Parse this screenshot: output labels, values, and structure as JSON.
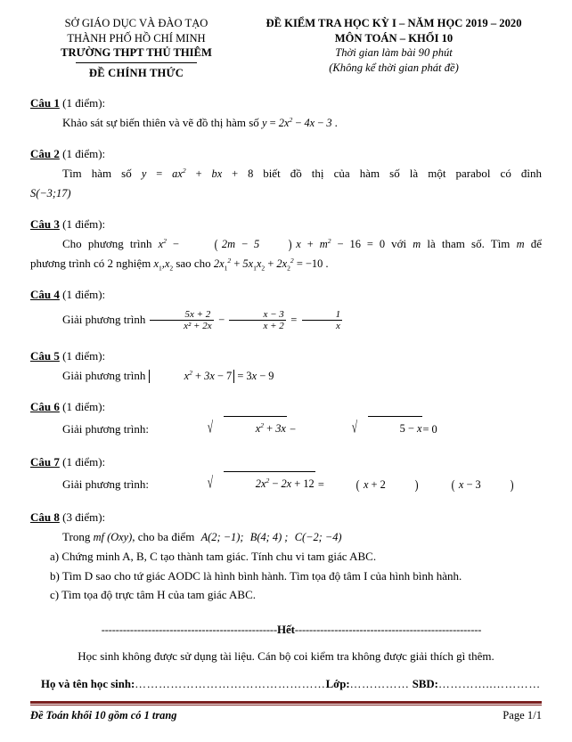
{
  "header": {
    "left": {
      "line1": "SỞ GIÁO DỤC VÀ ĐÀO TẠO",
      "line2": "THÀNH PHỐ HỒ CHÍ MINH",
      "line3": "TRƯỜNG THPT THỦ THIÊM",
      "stamp": "ĐỀ CHÍNH THỨC"
    },
    "right": {
      "line1": "ĐỀ KIỂM TRA HỌC KỲ I – NĂM HỌC 2019 – 2020",
      "line2": "MÔN TOÁN – KHỐI 10",
      "line3": "Thời gian làm bài 90 phút",
      "line4": "(Không kể thời gian phát đề)"
    }
  },
  "questions": [
    {
      "label": "Câu 1",
      "points": "(1 điểm):",
      "text_before": "Khảo sát sự biến thiên và vẽ đồ thị hàm số",
      "equation": "y = 2x² − 4x − 3",
      "text_after": "."
    },
    {
      "label": "Câu 2",
      "points": "(1 điểm):",
      "text_before": "Tìm hàm số",
      "equation": "y = ax² + bx + 8",
      "text_after": "biết đồ thị của hàm số là một parabol có đỉnh",
      "line2": "S(−3;17)"
    },
    {
      "label": "Câu 3",
      "points": "(1 điểm):",
      "text_before": "Cho phương trình",
      "equation": "x² − (2m − 5)x + m² − 16 = 0",
      "text_mid": "với",
      "param": "m",
      "text_after": "là tham số. Tìm",
      "param2": "m",
      "text_end": "để",
      "line2_before": "phương trình có 2 nghiệm",
      "line2_roots": "x₁, x₂",
      "line2_mid": "sao cho",
      "line2_eq": "2x₁² + 5x₁x₂ + 2x₂² = −10",
      "line2_end": "."
    },
    {
      "label": "Câu 4",
      "points": "(1 điểm):",
      "text_before": "Giải phương trình",
      "fractions": {
        "f1_num": "5x + 2",
        "f1_den": "x² + 2x",
        "op1": "−",
        "f2_num": "x − 3",
        "f2_den": "x + 2",
        "op2": "=",
        "f3_num": "1",
        "f3_den": "x"
      }
    },
    {
      "label": "Câu 5",
      "points": "(1 điểm):",
      "text_before": "Giải phương trình",
      "abs_inner": "x² + 3x − 7",
      "rhs": "= 3x − 9"
    },
    {
      "label": "Câu 6",
      "points": "(1 điểm):",
      "text_before": "Giải phương trình:",
      "sqrt1": "x² + 3x",
      "op": "−",
      "sqrt2": "5 − x",
      "rhs": "= 0"
    },
    {
      "label": "Câu 7",
      "points": "(1 điểm):",
      "text_before": "Giải phương trình:",
      "sqrt1": "2x² − 2x + 12",
      "eq": "=",
      "rhs1": "x + 2",
      "rhs2": "x − 3"
    },
    {
      "label": "Câu 8",
      "points": "(3 điểm):",
      "intro_before": "Trong",
      "plane": "mf (Oxy)",
      "intro_after": ", cho ba điểm",
      "pointA": "A(2; −1);",
      "pointB": "B(4; 4) ;",
      "pointC": "C(−2; −4)",
      "parts": [
        "a) Chứng minh A, B, C tạo thành tam giác. Tính chu vi tam giác ABC.",
        "b) Tìm D sao cho tứ giác AODC là hình bình hành. Tìm tọa độ tâm I của hình bình hành.",
        "c) Tìm tọa độ trực tâm H của tam giác ABC."
      ]
    }
  ],
  "footer": {
    "het_dashes_left": "-------------------------------------------------",
    "het_word": "Hết",
    "het_dashes_right": "----------------------------------------------------",
    "note": "Học sinh không được sử dụng tài liệu. Cán bộ coi kiểm tra không được giải thích gì thêm.",
    "info_name_label": "Họ và tên học sinh:",
    "info_dots1": "…………………………………………",
    "info_class_label": "Lớp:",
    "info_dots2": "……………",
    "info_sbd_label": "SBD:",
    "info_dots3": "…………..…………",
    "page_note": "Đề Toán khối 10 gồm có 1 trang",
    "page_number": "Page 1/1",
    "rule_color": "#7b2120"
  }
}
